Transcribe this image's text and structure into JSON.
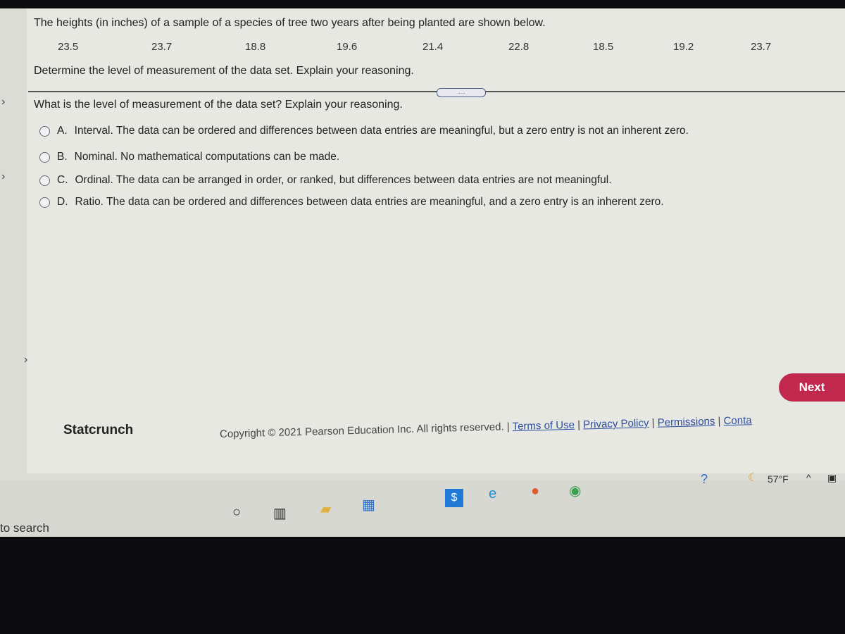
{
  "question": {
    "intro": "The heights (in inches) of a sample of a species of tree two years after being planted are shown below.",
    "data_values": [
      "23.5",
      "23.7",
      "18.8",
      "19.6",
      "21.4",
      "22.8",
      "18.5",
      "19.2",
      "23.7"
    ],
    "instruction": "Determine the level of measurement of the data set. Explain your reasoning.",
    "prompt": "What is the level of measurement of the data set? Explain your reasoning.",
    "divider_handle": "....."
  },
  "options": [
    {
      "letter": "A.",
      "text": "Interval. The data can be ordered and differences between data entries are meaningful, but a zero entry is not an inherent zero."
    },
    {
      "letter": "B.",
      "text": "Nominal. No mathematical computations can be made."
    },
    {
      "letter": "C.",
      "text": "Ordinal. The data can be arranged in order, or ranked, but differences between data entries are not meaningful."
    },
    {
      "letter": "D.",
      "text": "Ratio. The data can be ordered and differences between data entries are meaningful, and a zero entry is an inherent zero."
    }
  ],
  "next_label": "Next",
  "statcrunch_label": "Statcrunch",
  "footer": {
    "copyright": "Copyright © 2021 Pearson Education Inc. All rights reserved. |",
    "links": [
      "Terms of Use",
      "Privacy Policy",
      "Permissions",
      "Conta"
    ]
  },
  "taskbar": {
    "search_text": "to search",
    "weather": "57°F",
    "accent": "#c0284e"
  }
}
